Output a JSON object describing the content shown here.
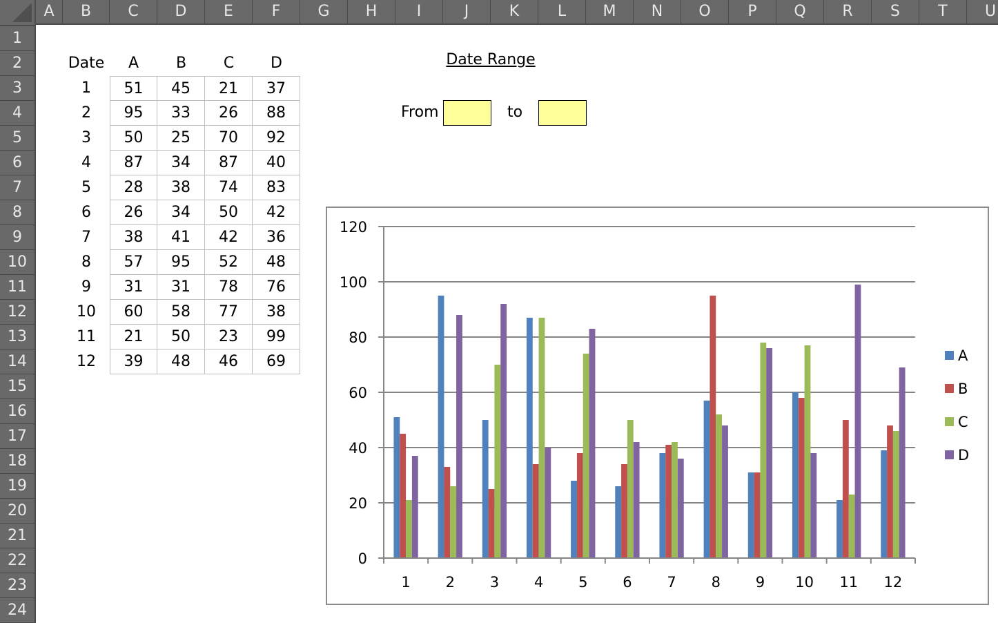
{
  "sheet": {
    "columns": [
      "A",
      "B",
      "C",
      "D",
      "E",
      "F",
      "G",
      "H",
      "I",
      "J",
      "K",
      "L",
      "M",
      "N",
      "O",
      "P",
      "Q",
      "R",
      "S",
      "T",
      "U"
    ],
    "rows": [
      "1",
      "2",
      "3",
      "4",
      "5",
      "6",
      "7",
      "8",
      "9",
      "10",
      "11",
      "12",
      "13",
      "14",
      "15",
      "16",
      "17",
      "18",
      "19",
      "20",
      "21",
      "22",
      "23",
      "24"
    ]
  },
  "table": {
    "headers": [
      "Date",
      "A",
      "B",
      "C",
      "D"
    ],
    "rows": [
      [
        "1",
        "51",
        "45",
        "21",
        "37"
      ],
      [
        "2",
        "95",
        "33",
        "26",
        "88"
      ],
      [
        "3",
        "50",
        "25",
        "70",
        "92"
      ],
      [
        "4",
        "87",
        "34",
        "87",
        "40"
      ],
      [
        "5",
        "28",
        "38",
        "74",
        "83"
      ],
      [
        "6",
        "26",
        "34",
        "50",
        "42"
      ],
      [
        "7",
        "38",
        "41",
        "42",
        "36"
      ],
      [
        "8",
        "57",
        "95",
        "52",
        "48"
      ],
      [
        "9",
        "31",
        "31",
        "78",
        "76"
      ],
      [
        "10",
        "60",
        "58",
        "77",
        "38"
      ],
      [
        "11",
        "21",
        "50",
        "23",
        "99"
      ],
      [
        "12",
        "39",
        "48",
        "46",
        "69"
      ]
    ]
  },
  "date_range": {
    "title": "Date Range",
    "from_label": "From",
    "to_label": "to",
    "from_value": "",
    "to_value": "",
    "input_color": "#ffff99"
  },
  "chart_data": {
    "type": "bar",
    "title": "",
    "xlabel": "",
    "ylabel": "",
    "categories": [
      "1",
      "2",
      "3",
      "4",
      "5",
      "6",
      "7",
      "8",
      "9",
      "10",
      "11",
      "12"
    ],
    "series": [
      {
        "name": "A",
        "color": "#4f81bd",
        "values": [
          51,
          95,
          50,
          87,
          28,
          26,
          38,
          57,
          31,
          60,
          21,
          39
        ]
      },
      {
        "name": "B",
        "color": "#c0504d",
        "values": [
          45,
          33,
          25,
          34,
          38,
          34,
          41,
          95,
          31,
          58,
          50,
          48
        ]
      },
      {
        "name": "C",
        "color": "#9bbb59",
        "values": [
          21,
          26,
          70,
          87,
          74,
          50,
          42,
          52,
          78,
          77,
          23,
          46
        ]
      },
      {
        "name": "D",
        "color": "#8064a2",
        "values": [
          37,
          88,
          92,
          40,
          83,
          42,
          36,
          48,
          76,
          38,
          99,
          69
        ]
      }
    ],
    "ylim": [
      0,
      120
    ],
    "yticks": [
      "0",
      "20",
      "40",
      "60",
      "80",
      "100",
      "120"
    ],
    "grid": true,
    "legend_position": "right"
  }
}
